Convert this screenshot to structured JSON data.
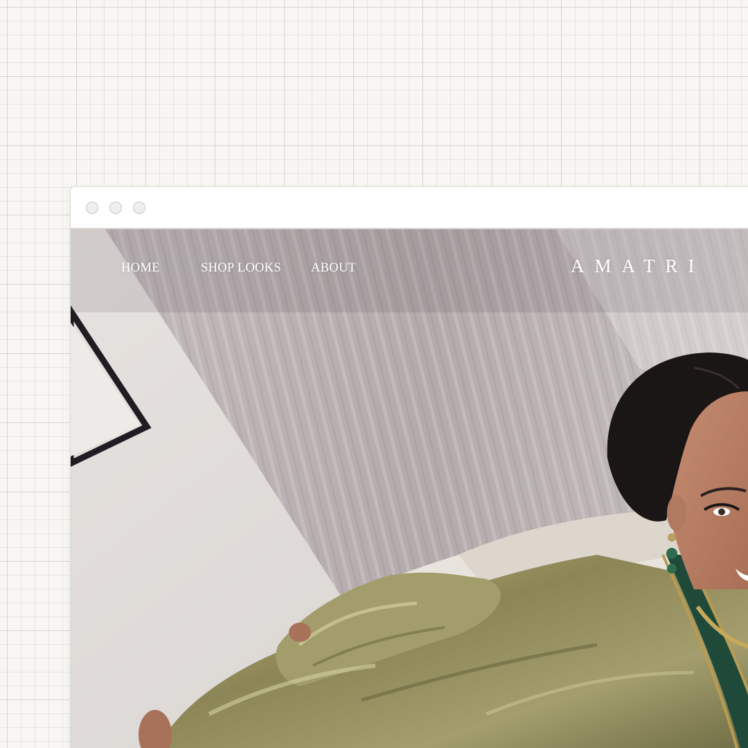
{
  "browser": {
    "window_controls": [
      "close",
      "minimize",
      "maximize"
    ]
  },
  "site": {
    "brand": "AMATRI",
    "nav": {
      "home": "HOME",
      "shop_looks": "SHOP LOOKS",
      "about": "ABOUT"
    }
  },
  "colors": {
    "background": "#f7f6f3",
    "nav_text": "#ffffff",
    "garment_gold": "#8a8650",
    "border_green": "#1f4a3a"
  }
}
